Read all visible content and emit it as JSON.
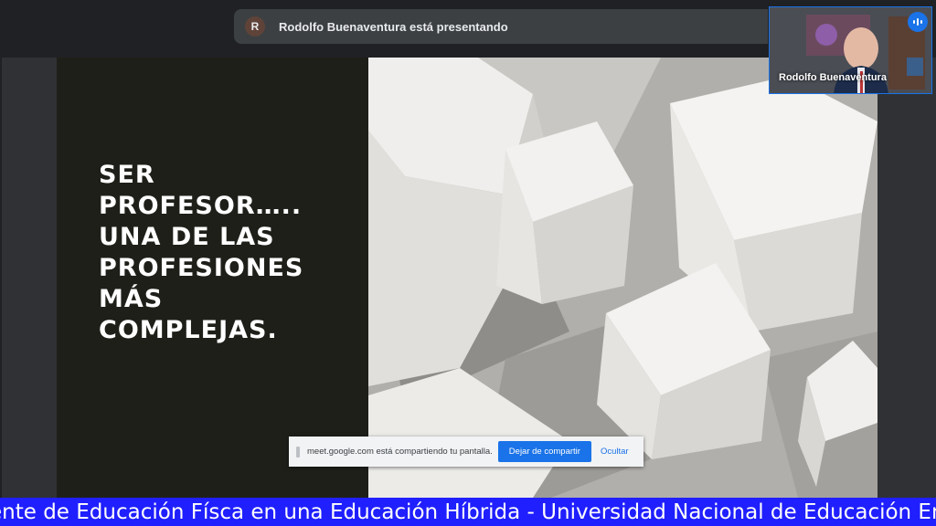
{
  "presenter_banner": {
    "avatar_initial": "R",
    "text": "Rodolfo Buenaventura está presentando"
  },
  "slide": {
    "title": "SER\nPROFESOR…..\nUNA DE LAS\nPROFESIONES\nMÁS\nCOMPLEJAS."
  },
  "self_view": {
    "name": "Rodolfo Buenaventura",
    "audio_icon": "audio-level-icon"
  },
  "share_bar": {
    "message": "meet.google.com está compartiendo tu pantalla.",
    "stop_label": "Dejar de compartir",
    "hide_label": "Ocultar"
  },
  "ticker": {
    "text": "ente de Educación Físca en una Educación Híbrida - Universidad Nacional de Educación Enriqu"
  },
  "colors": {
    "accent": "#1a73e8",
    "ticker_bg": "#1f1fff",
    "slide_dark": "#1f1f1a",
    "meet_bg": "#202124"
  }
}
